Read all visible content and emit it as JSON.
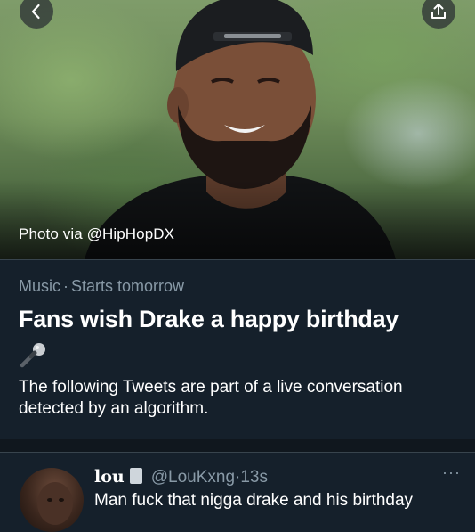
{
  "hero": {
    "photo_credit": "Photo via @HipHopDX",
    "back_icon": "chevron-left-icon",
    "share_icon": "share-icon"
  },
  "event": {
    "category": "Music",
    "separator": "·",
    "status": "Starts tomorrow",
    "title": "Fans wish Drake a happy birthday",
    "emoji_icon": "microphone-icon",
    "description": "The following Tweets are part of a live conversation detected by an algorithm."
  },
  "tweet": {
    "display_name": "lou",
    "handle": "@LouKxng",
    "separator": "·",
    "time": "13s",
    "more_label": "···",
    "text": "Man fuck that nigga drake and his birthday"
  },
  "colors": {
    "background": "#15202b",
    "secondary_text": "#8899a6",
    "divider": "#38444d"
  }
}
